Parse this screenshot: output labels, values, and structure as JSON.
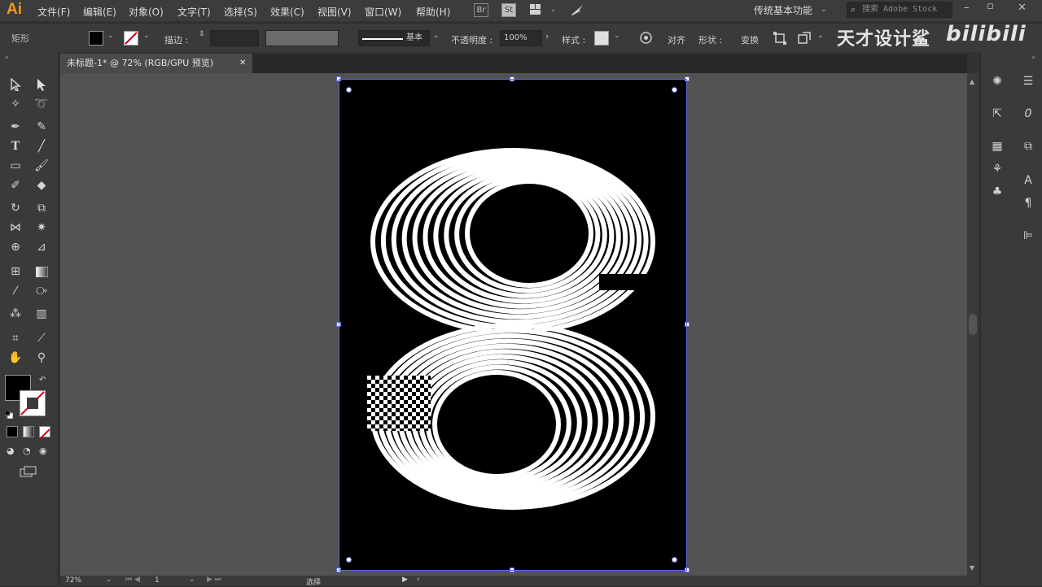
{
  "app": {
    "logo": "Ai"
  },
  "menu": [
    "文件(F)",
    "编辑(E)",
    "对象(O)",
    "文字(T)",
    "选择(S)",
    "效果(C)",
    "视图(V)",
    "窗口(W)",
    "帮助(H)"
  ],
  "menubar_icons": {
    "br": "Br",
    "st": "St"
  },
  "workspace": "传统基本功能",
  "search": {
    "placeholder": "搜索 Adobe Stock"
  },
  "control": {
    "tool_name": "矩形",
    "stroke_label": "描边 :",
    "stroke_style": "基本",
    "opacity_label": "不透明度 :",
    "opacity_value": "100%",
    "style_label": "样式 :",
    "align_label": "对齐",
    "shape_label": "形状 :",
    "transform_label": "变换"
  },
  "watermark": {
    "cn": "天才设计鲨",
    "bili": "bilibili"
  },
  "tab": {
    "title": "未标题-1* @ 72% (RGB/GPU 预览)",
    "close": "✕"
  },
  "status": {
    "zoom": "72%",
    "artboard_num": "1",
    "mode": "选择"
  },
  "colors": {
    "accent": "#5a6ad8",
    "logo": "#ee9a1c",
    "artboard": "#000000",
    "art": "#ffffff"
  },
  "icons": [
    "selection-tool-icon",
    "direct-selection-icon",
    "magic-wand-icon",
    "lasso-icon",
    "pen-icon",
    "curvature-icon",
    "type-icon",
    "line-icon",
    "rectangle-icon",
    "paintbrush-icon",
    "shaper-icon",
    "eraser-icon",
    "rotate-icon",
    "scale-icon",
    "width-icon",
    "puppet-warp-icon",
    "shape-builder-icon",
    "perspective-icon",
    "mesh-icon",
    "gradient-icon",
    "eyedropper-icon",
    "blend-icon",
    "symbol-sprayer-icon",
    "graph-icon",
    "artboard-icon",
    "slice-icon",
    "hand-icon",
    "zoom-icon"
  ]
}
